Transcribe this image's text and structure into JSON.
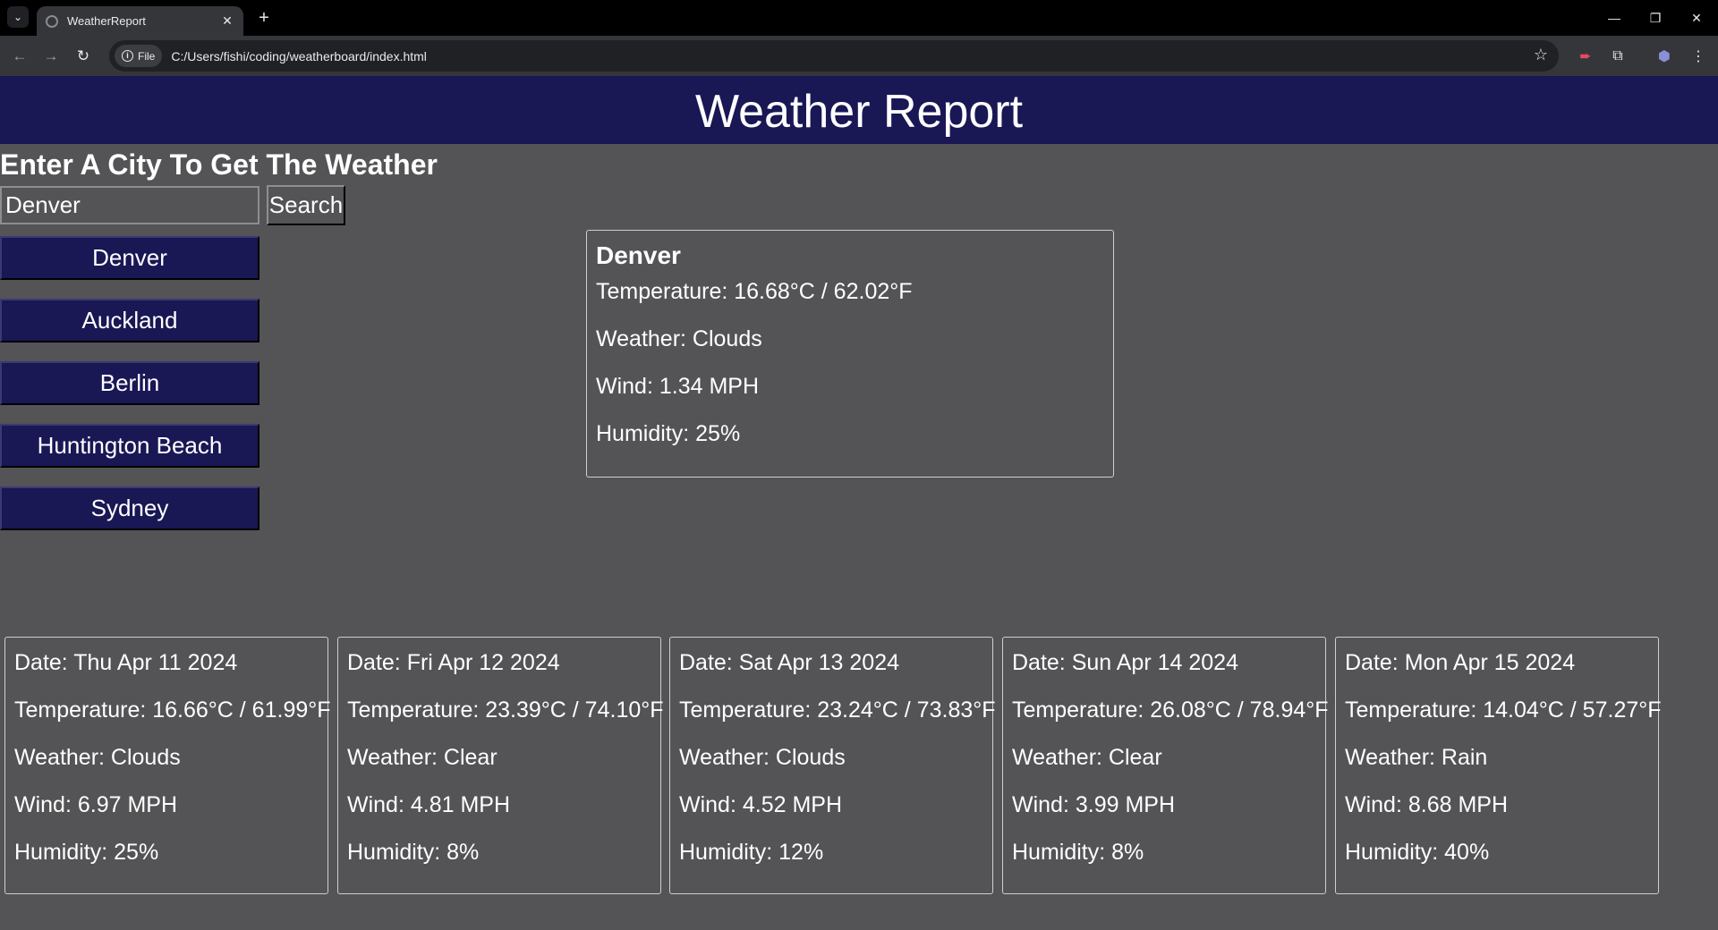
{
  "browser": {
    "tab_title": "WeatherReport",
    "url_chip": "File",
    "url": "C:/Users/fishi/coding/weatherboard/index.html"
  },
  "header": {
    "title": "Weather Report"
  },
  "search": {
    "heading": "Enter A City To Get The Weather",
    "input_value": "Denver",
    "button_label": "Search"
  },
  "history": [
    "Denver",
    "Auckland",
    "Berlin",
    "Huntington Beach",
    "Sydney"
  ],
  "current": {
    "city": "Denver",
    "temperature": "Temperature: 16.68°C / 62.02°F",
    "weather": "Weather: Clouds",
    "wind": "Wind: 1.34 MPH",
    "humidity": "Humidity: 25%"
  },
  "forecast": [
    {
      "date": "Date: Thu Apr 11 2024",
      "temperature": "Temperature: 16.66°C / 61.99°F",
      "weather": "Weather: Clouds",
      "wind": "Wind: 6.97 MPH",
      "humidity": "Humidity: 25%"
    },
    {
      "date": "Date: Fri Apr 12 2024",
      "temperature": "Temperature: 23.39°C / 74.10°F",
      "weather": "Weather: Clear",
      "wind": "Wind: 4.81 MPH",
      "humidity": "Humidity: 8%"
    },
    {
      "date": "Date: Sat Apr 13 2024",
      "temperature": "Temperature: 23.24°C / 73.83°F",
      "weather": "Weather: Clouds",
      "wind": "Wind: 4.52 MPH",
      "humidity": "Humidity: 12%"
    },
    {
      "date": "Date: Sun Apr 14 2024",
      "temperature": "Temperature: 26.08°C / 78.94°F",
      "weather": "Weather: Clear",
      "wind": "Wind: 3.99 MPH",
      "humidity": "Humidity: 8%"
    },
    {
      "date": "Date: Mon Apr 15 2024",
      "temperature": "Temperature: 14.04°C / 57.27°F",
      "weather": "Weather: Rain",
      "wind": "Wind: 8.68 MPH",
      "humidity": "Humidity: 40%"
    }
  ],
  "colors": {
    "header_bg": "#191754",
    "page_bg": "#545355",
    "button_bg": "#191754"
  }
}
